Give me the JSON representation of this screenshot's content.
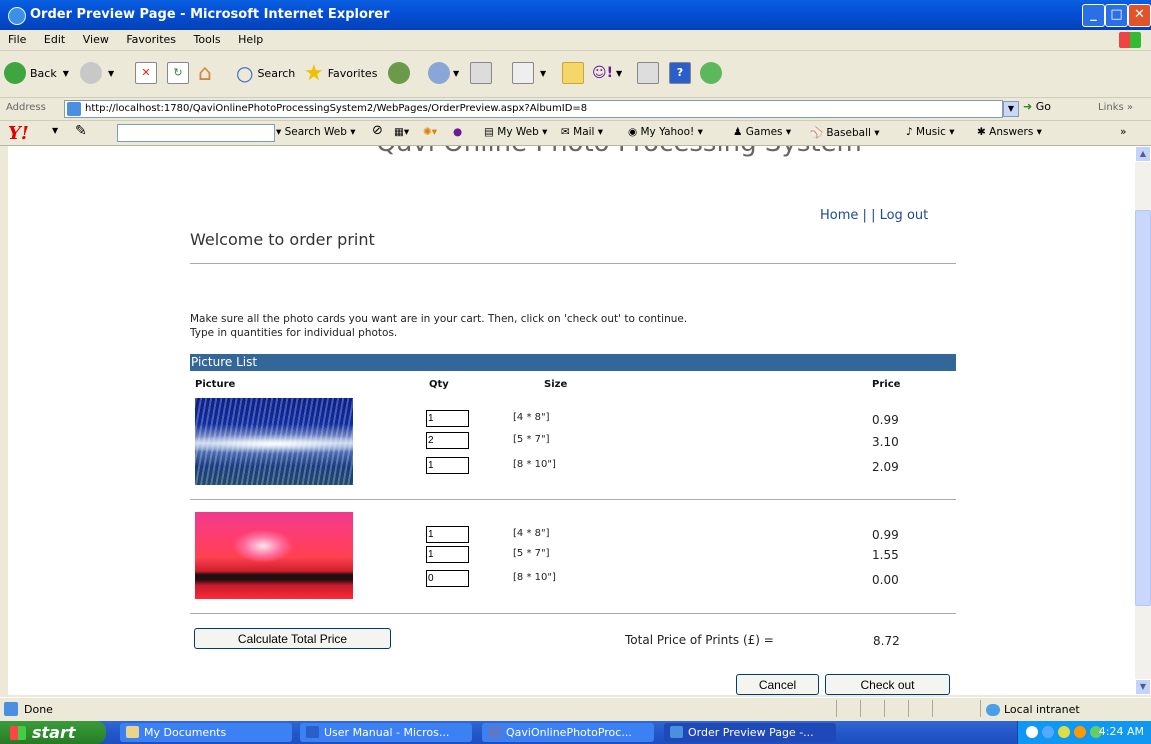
{
  "window": {
    "title": "Order Preview Page - Microsoft Internet Explorer"
  },
  "menu": [
    "File",
    "Edit",
    "View",
    "Favorites",
    "Tools",
    "Help"
  ],
  "toolbar": {
    "back": "Back",
    "search": "Search",
    "favorites": "Favorites"
  },
  "address": {
    "label": "Address",
    "url": "http://localhost:1780/QaviOnlinePhotoProcessingSystem2/WebPages/OrderPreview.aspx?AlbumID=8",
    "go": "Go",
    "links": "Links"
  },
  "yahoo": {
    "search_web": "Search Web",
    "my_web": "My Web",
    "mail": "Mail",
    "my_yahoo": "My Yahoo!",
    "games": "Games",
    "baseball": "Baseball",
    "music": "Music",
    "answers": "Answers"
  },
  "page": {
    "site_title": "Qavi Online Photo Processing System",
    "nav_home": "Home",
    "nav_sep1": "|",
    "nav_sep2": "|",
    "nav_logout": "Log out",
    "welcome": "Welcome to order print",
    "instruction_1": "Make sure all the photo cards you want are in your cart. Then, click on 'check out' to continue.",
    "instruction_2": "Type in quantities for individual photos.",
    "list_header": "Picture List",
    "columns": {
      "picture": "Picture",
      "qty": "Qty",
      "size": "Size",
      "price": "Price"
    },
    "items": [
      {
        "sizes": [
          {
            "qty": "1",
            "size": "[4 * 8\"]",
            "price": "0.99"
          },
          {
            "qty": "2",
            "size": "[5 * 7\"]",
            "price": "3.10"
          },
          {
            "qty": "1",
            "size": "[8 * 10\"]",
            "price": "2.09"
          }
        ]
      },
      {
        "sizes": [
          {
            "qty": "1",
            "size": "[4 * 8\"]",
            "price": "0.99"
          },
          {
            "qty": "1",
            "size": "[5 * 7\"]",
            "price": "1.55"
          },
          {
            "qty": "0",
            "size": "[8 * 10\"]",
            "price": "0.00"
          }
        ]
      }
    ],
    "calculate_button": "Calculate Total Price",
    "total_label": "Total Price of Prints (£) =",
    "total_value": "8.72",
    "cancel_button": "Cancel",
    "checkout_button": "Check out"
  },
  "status": {
    "text": "Done",
    "zone": "Local intranet"
  },
  "taskbar": {
    "start": "start",
    "tasks": [
      "My Documents",
      "User Manual - Micros...",
      "QaviOnlinePhotoProc...",
      "Order Preview Page -..."
    ],
    "clock": "4:24 AM"
  },
  "icons": {
    "ie": "ie-icon",
    "back": "back-arrow-icon",
    "forward": "forward-arrow-icon",
    "stop": "stop-icon",
    "refresh": "refresh-icon",
    "home": "home-icon",
    "search": "search-icon",
    "favorites": "star-icon",
    "history": "history-icon",
    "mail": "mail-icon",
    "print": "print-icon"
  },
  "colors": {
    "titlebar": "#0450d6",
    "list_header": "#336699",
    "link": "#1e4a8c",
    "taskbar": "#2457c8",
    "start": "#2f8f2f"
  }
}
